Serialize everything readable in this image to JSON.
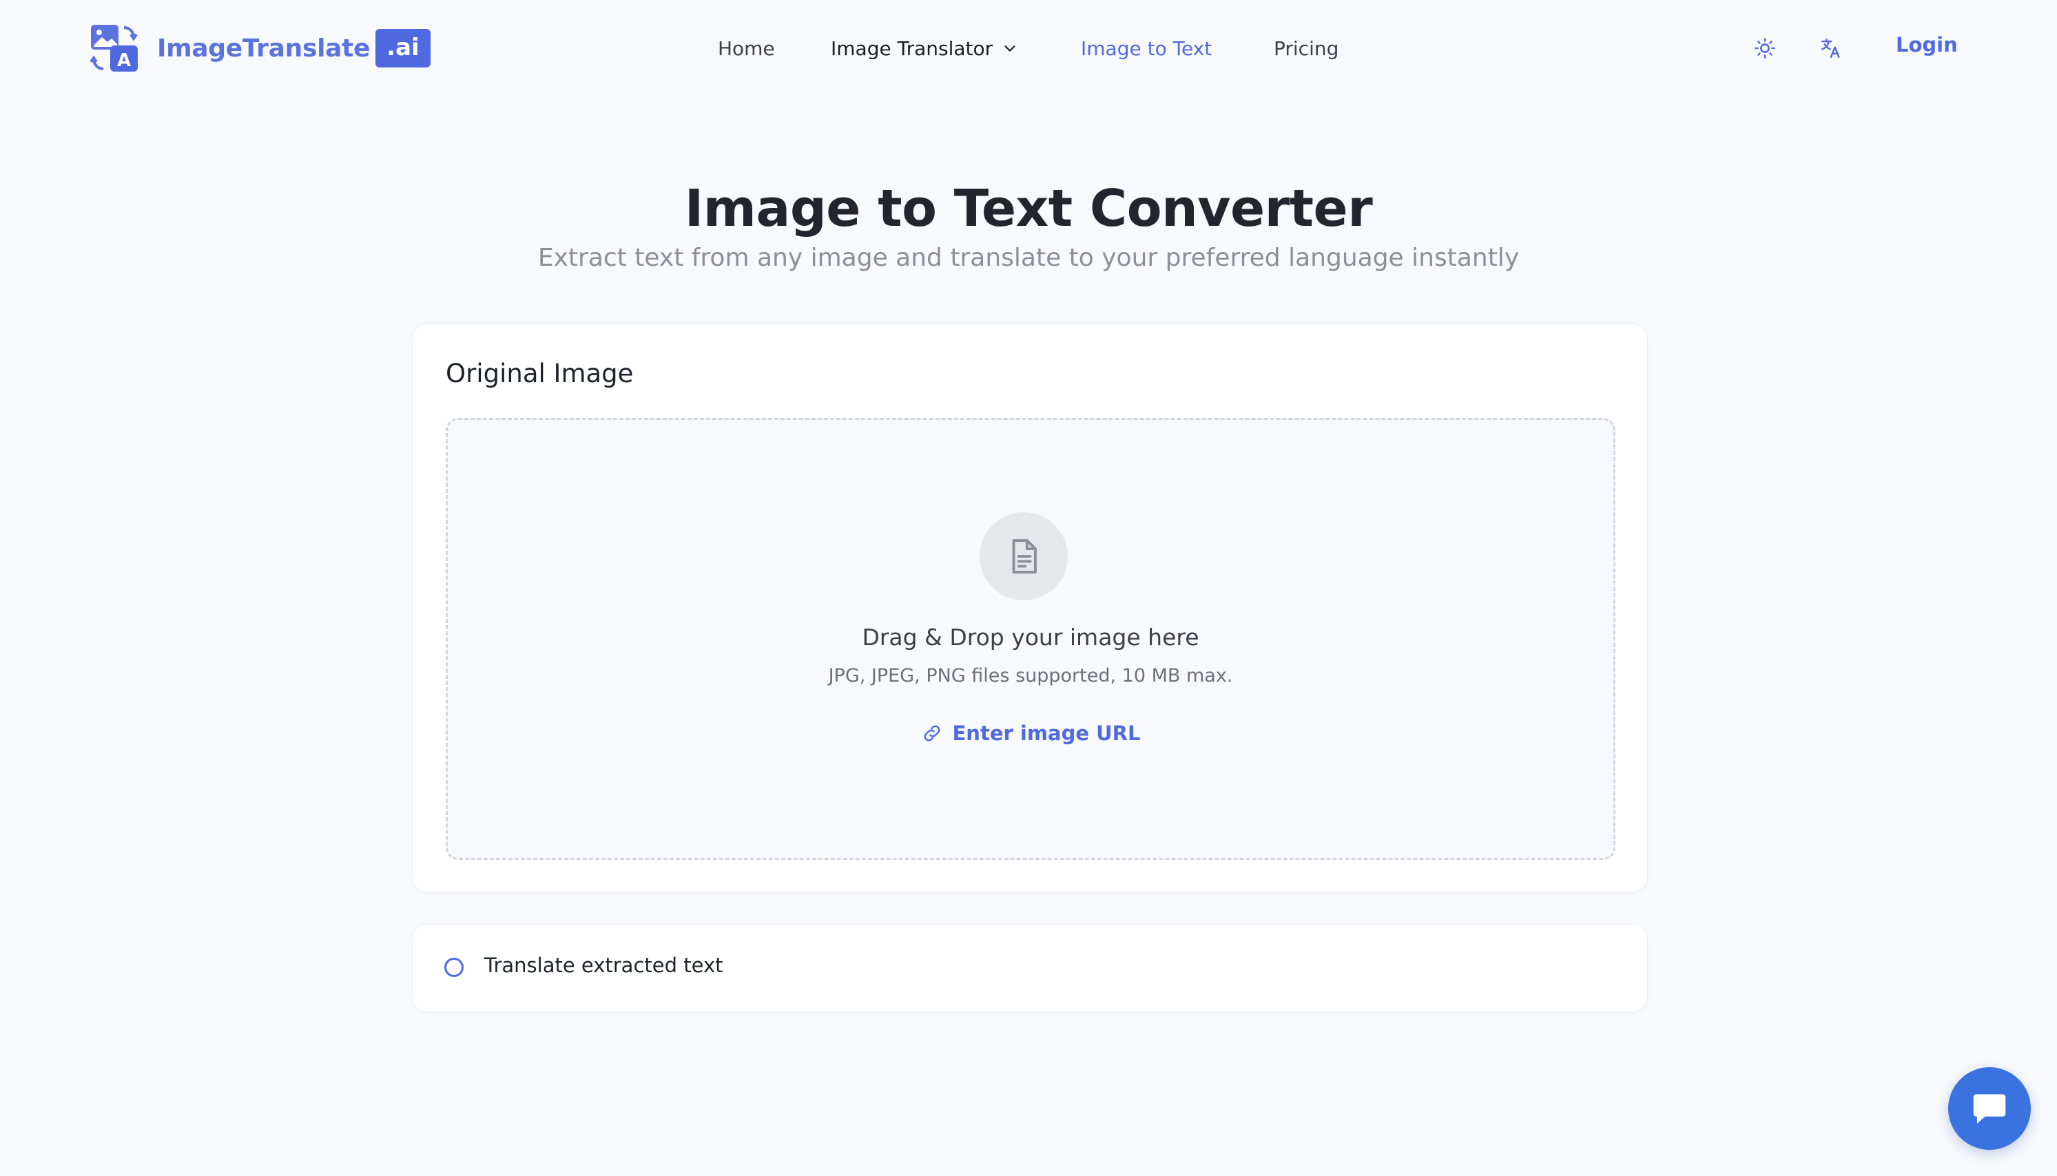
{
  "brand": {
    "name": "ImageTranslate",
    "badge": ".ai",
    "accent": "#4f6ae0"
  },
  "nav": {
    "home": "Home",
    "image_translator": "Image Translator",
    "image_to_text": "Image to Text",
    "pricing": "Pricing",
    "active": "Image to Text"
  },
  "header_actions": {
    "theme_icon": "sun-icon",
    "language_icon": "translate-icon",
    "login": "Login"
  },
  "hero": {
    "title": "Image to Text Converter",
    "subtitle": "Extract text from any image and translate to your preferred language instantly"
  },
  "upload": {
    "card_title": "Original Image",
    "icon": "document-icon",
    "drop_title": "Drag & Drop your image here",
    "drop_subtitle": "JPG, JPEG, PNG files supported, 10 MB max.",
    "url_link": "Enter image URL"
  },
  "translate_option": {
    "label": "Translate extracted text",
    "checked": false
  },
  "chat": {
    "icon": "chat-icon",
    "color": "#3a73e0"
  }
}
